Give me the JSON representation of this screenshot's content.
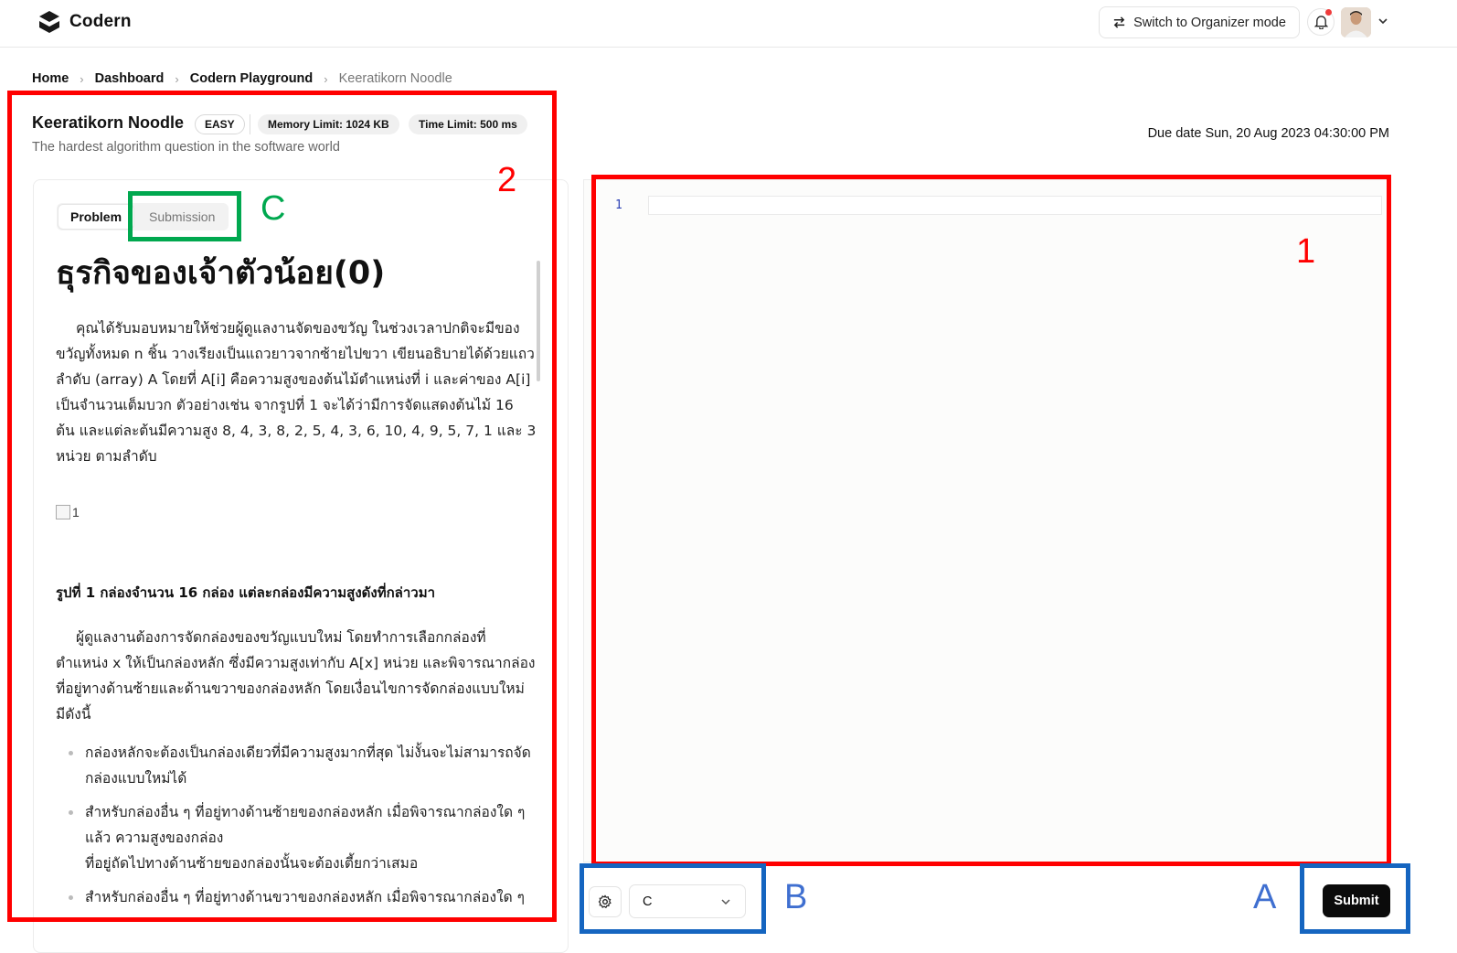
{
  "header": {
    "brand": "Codern",
    "organizer_label": "Switch to Organizer mode"
  },
  "breadcrumb": [
    "Home",
    "Dashboard",
    "Codern Playground",
    "Keeratikorn Noodle"
  ],
  "problem": {
    "title": "Keeratikorn Noodle",
    "difficulty": "EASY",
    "memory_limit": "Memory Limit: 1024 KB",
    "time_limit": "Time Limit: 500 ms",
    "subtitle": "The hardest algorithm question in the software world",
    "due_date": "Due date Sun, 20 Aug 2023 04:30:00 PM"
  },
  "tabs": {
    "problem": "Problem",
    "submission": "Submission"
  },
  "content": {
    "heading": "ธุรกิจของเจ้าตัวน้อย(0)",
    "paragraph1": "คุณได้รับมอบหมายให้ช่วยผู้ดูแลงานจัดของขวัญ ในช่วงเวลาปกติจะมีของขวัญทั้งหมด n ชิ้น วางเรียงเป็นแถวยาวจากซ้ายไปขวา เขียนอธิบายได้ด้วยแถวลำดับ (array) A โดยที่ A[i] คือความสูงของต้นไม้ตำแหน่งที่ i และค่าของ A[i] เป็นจำนวนเต็มบวก ตัวอย่างเช่น จากรูปที่ 1 จะได้ว่ามีการจัดแสดงต้นไม้ 16 ต้น และแต่ละต้นมีความสูง 8, 4, 3, 8, 2, 5, 4, 3, 6, 10, 4, 9, 5, 7, 1 และ 3 หน่วย ตามลำดับ",
    "image_alt": "1",
    "figure_caption": "รูปที่ 1 กล่องจำนวน 16 กล่อง แต่ละกล่องมีความสูงดังที่กล่าวมา",
    "paragraph2": "ผู้ดูแลงานต้องการจัดกล่องของขวัญแบบใหม่ โดยทำการเลือกกล่องที่ตำแหน่ง x ให้เป็นกล่องหลัก ซึ่งมีความสูงเท่ากับ A[x] หน่วย และพิจารณากล่องที่อยู่ทางด้านซ้ายและด้านขวาของกล่องหลัก โดยเงื่อนไขการจัดกล่องแบบใหม่ มีดังนี้",
    "bullets": [
      "กล่องหลักจะต้องเป็นกล่องเดียวที่มีความสูงมากที่สุด ไม่งั้นจะไม่สามารถจัดกล่องแบบใหม่ได้",
      "สำหรับกล่องอื่น ๆ ที่อยู่ทางด้านซ้ายของกล่องหลัก เมื่อพิจารณากล่องใด ๆ แล้ว ความสูงของกล่อง\nที่อยู่ถัดไปทางด้านซ้ายของกล่องนั้นจะต้องเตี้ยกว่าเสมอ",
      "สำหรับกล่องอื่น ๆ ที่อยู่ทางด้านขวาของกล่องหลัก เมื่อพิจารณากล่องใด ๆ"
    ]
  },
  "editor": {
    "line_number": "1"
  },
  "footer": {
    "language": "C",
    "submit_label": "Submit"
  },
  "annotations": {
    "label_editor": "1",
    "label_problem": "2",
    "label_submission_tab": "C",
    "label_language": "B",
    "label_submit": "A"
  },
  "colors": {
    "annotation_red": "#ff0000",
    "annotation_green": "#00a84f",
    "annotation_blue": "#1565c0",
    "submit_bg": "#0b0b0b",
    "line_number": "#2a3fb4",
    "notification_dot": "#ef3b3b"
  },
  "icons": [
    "codern-logo-icon",
    "swap-arrows-icon",
    "bell-icon",
    "chevron-down-icon",
    "chevron-right-icon",
    "gear-icon",
    "broken-image-icon"
  ]
}
